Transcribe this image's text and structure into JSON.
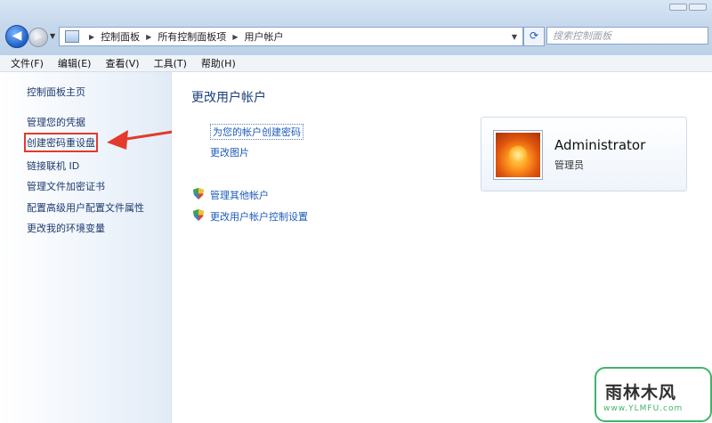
{
  "address_bar": {
    "breadcrumbs": [
      "控制面板",
      "所有控制面板项",
      "用户帐户"
    ]
  },
  "search": {
    "placeholder": "搜索控制面板"
  },
  "menu": [
    "文件(F)",
    "编辑(E)",
    "查看(V)",
    "工具(T)",
    "帮助(H)"
  ],
  "sidebar": {
    "items": [
      {
        "label": "控制面板主页"
      },
      {
        "label": "管理您的凭据"
      },
      {
        "label": "创建密码重设盘",
        "highlighted": true
      },
      {
        "label": "链接联机 ID"
      },
      {
        "label": "管理文件加密证书"
      },
      {
        "label": "配置高级用户配置文件属性"
      },
      {
        "label": "更改我的环境变量"
      }
    ]
  },
  "main": {
    "title": "更改用户帐户",
    "tasks": [
      "为您的帐户创建密码",
      "更改图片"
    ],
    "shield_tasks": [
      "管理其他帐户",
      "更改用户帐户控制设置"
    ]
  },
  "user": {
    "name": "Administrator",
    "role": "管理员"
  },
  "watermark": {
    "logo_text": "雨林木风",
    "url": "www.YLMFU.com"
  },
  "colors": {
    "highlight_red": "#e23a2c",
    "link_blue": "#1e5bb8",
    "logo_green": "#41b36a"
  }
}
